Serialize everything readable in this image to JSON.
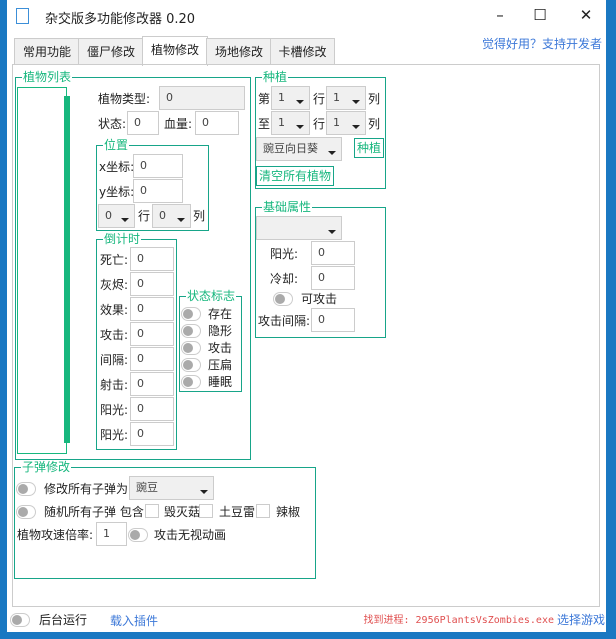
{
  "window": {
    "title": "杂交版多功能修改器  0.20",
    "minimize": "–",
    "maximize": "☐",
    "close": "✕"
  },
  "support_link": "觉得好用？支持开发者",
  "tabs": [
    "常用功能",
    "僵尸修改",
    "植物修改",
    "场地修改",
    "卡槽修改"
  ],
  "active_tab": "植物修改",
  "plant_list": {
    "label": "植物列表",
    "type_label": "植物类型:",
    "type_value": "0",
    "state_label": "状态:",
    "state_value": "0",
    "hp_label": "血量:",
    "hp_value": "0",
    "position": {
      "label": "位置",
      "x_label": "x坐标:",
      "x_value": "0",
      "y_label": "y坐标:",
      "y_value": "0",
      "row_value": "0",
      "row_label": "行",
      "col_value": "0",
      "col_label": "列"
    },
    "countdown": {
      "label": "倒计时",
      "rows": [
        {
          "label": "死亡:",
          "value": "0"
        },
        {
          "label": "灰烬:",
          "value": "0"
        },
        {
          "label": "效果:",
          "value": "0"
        },
        {
          "label": "攻击:",
          "value": "0"
        },
        {
          "label": "间隔:",
          "value": "0"
        },
        {
          "label": "射击:",
          "value": "0"
        },
        {
          "label": "阳光:",
          "value": "0"
        },
        {
          "label": "阳光:",
          "value": "0"
        }
      ]
    },
    "flags": {
      "label": "状态标志",
      "items": [
        "存在",
        "隐形",
        "攻击",
        "压扁",
        "睡眠"
      ]
    }
  },
  "planting": {
    "label": "种植",
    "from_label": "第",
    "to_label": "至",
    "row_label": "行",
    "col_label": "列",
    "from_row": "1",
    "from_col": "1",
    "to_row": "1",
    "to_col": "1",
    "plant": "豌豆向日葵",
    "plant_button": "种植",
    "clear_button": "清空所有植物"
  },
  "base_attr": {
    "label": "基础属性",
    "select": "",
    "sun_label": "阳光:",
    "sun_value": "0",
    "cd_label": "冷却:",
    "cd_value": "0",
    "attack_toggle": "可攻击",
    "interval_label": "攻击间隔:",
    "interval_value": "0"
  },
  "bullet": {
    "label": "子弹修改",
    "modify_all": "修改所有子弹为",
    "bullet_type": "豌豆",
    "random_all": "随机所有子弹 包含",
    "opt1": "毁灭菇",
    "opt2": "土豆雷",
    "opt3": "辣椒",
    "speed_label": "植物攻速倍率:",
    "speed_value": "1",
    "ignore_anim": "攻击无视动画"
  },
  "footer": {
    "background_run": "后台运行",
    "load_plugin": "载入插件",
    "status": "找到进程: 2956PlantsVsZombies.exe",
    "select_game": "选择游戏"
  },
  "colors": {
    "accent": "#17b77e",
    "link": "#3c78d8",
    "status": "#e05050"
  }
}
